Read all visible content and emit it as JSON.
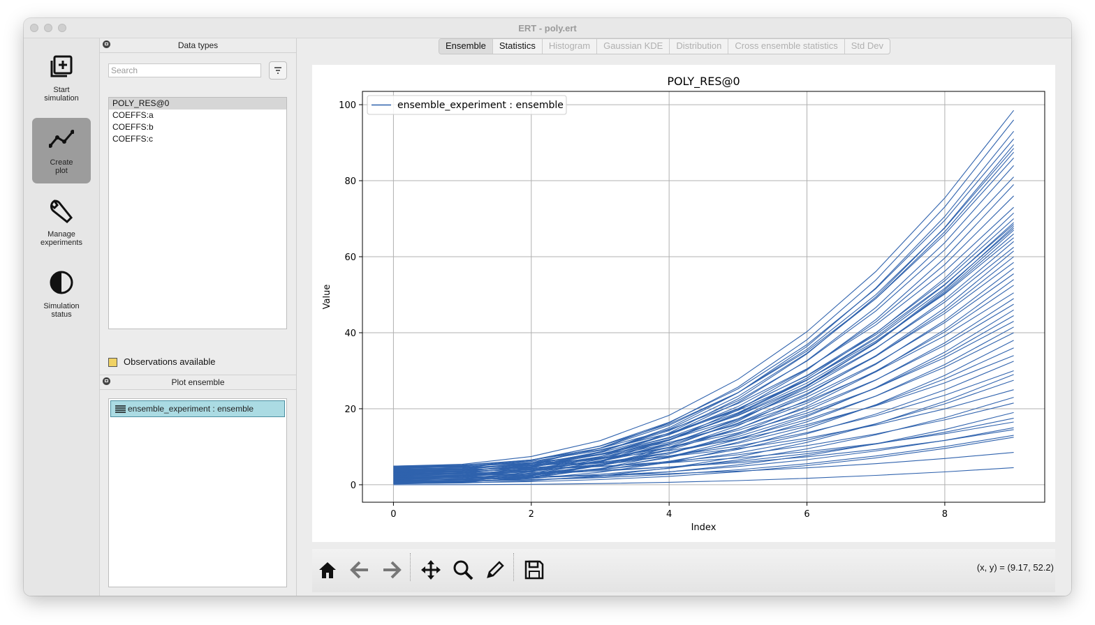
{
  "window": {
    "title": "ERT - poly.ert"
  },
  "sidebar": {
    "items": [
      {
        "label": "Start\nsimulation"
      },
      {
        "label": "Create\nplot"
      },
      {
        "label": "Manage\nexperiments"
      },
      {
        "label": "Simulation\nstatus"
      }
    ]
  },
  "data_types": {
    "title": "Data types",
    "search_placeholder": "Search",
    "items": [
      "POLY_RES@0",
      "COEFFS:a",
      "COEFFS:b",
      "COEFFS:c"
    ],
    "observations_label": "Observations available",
    "observations_color": "#f0d264"
  },
  "plot_ensemble": {
    "title": "Plot ensemble",
    "items": [
      "ensemble_experiment : ensemble"
    ]
  },
  "tabs": [
    "Ensemble",
    "Statistics",
    "Histogram",
    "Gaussian KDE",
    "Distribution",
    "Cross ensemble statistics",
    "Std Dev"
  ],
  "toolbar": {
    "coords": "(x, y) = (9.17, 52.2)"
  },
  "chart_data": {
    "type": "line",
    "title": "POLY_RES@0",
    "xlabel": "Index",
    "ylabel": "Value",
    "xlim": [
      -0.45,
      9.45
    ],
    "ylim": [
      -4.6,
      103.5
    ],
    "xticks": [
      0,
      2,
      4,
      6,
      8
    ],
    "yticks": [
      0,
      20,
      40,
      60,
      80,
      100
    ],
    "grid": true,
    "legend": "top-left",
    "legend_label": "ensemble_experiment : ensemble",
    "color": "#2f62ad",
    "x": [
      0,
      1,
      2,
      3,
      4,
      5,
      6,
      7,
      8,
      9
    ],
    "realization_endpoints": [
      {
        "y0": 0.0,
        "y9": 4.5
      },
      {
        "y0": 2.0,
        "y9": 8.5
      },
      {
        "y0": 0.5,
        "y9": 12.5
      },
      {
        "y0": 1.0,
        "y9": 13.0
      },
      {
        "y0": 3.0,
        "y9": 14.5
      },
      {
        "y0": 1.5,
        "y9": 15.0
      },
      {
        "y0": 4.0,
        "y9": 16.5
      },
      {
        "y0": 2.5,
        "y9": 17.5
      },
      {
        "y0": 0.8,
        "y9": 19.0
      },
      {
        "y0": 3.5,
        "y9": 21.5
      },
      {
        "y0": 1.2,
        "y9": 23.0
      },
      {
        "y0": 4.5,
        "y9": 25.0
      },
      {
        "y0": 2.2,
        "y9": 27.5
      },
      {
        "y0": 0.3,
        "y9": 29.0
      },
      {
        "y0": 3.8,
        "y9": 30.0
      },
      {
        "y0": 1.8,
        "y9": 32.5
      },
      {
        "y0": 4.8,
        "y9": 34.0
      },
      {
        "y0": 2.8,
        "y9": 36.0
      },
      {
        "y0": 0.6,
        "y9": 38.0
      },
      {
        "y0": 3.2,
        "y9": 40.0
      },
      {
        "y0": 1.4,
        "y9": 41.5
      },
      {
        "y0": 4.2,
        "y9": 43.0
      },
      {
        "y0": 2.4,
        "y9": 44.5
      },
      {
        "y0": 0.9,
        "y9": 46.0
      },
      {
        "y0": 3.6,
        "y9": 47.5
      },
      {
        "y0": 1.6,
        "y9": 49.0
      },
      {
        "y0": 4.6,
        "y9": 50.5
      },
      {
        "y0": 2.6,
        "y9": 52.5
      },
      {
        "y0": 0.4,
        "y9": 54.0
      },
      {
        "y0": 3.4,
        "y9": 55.5
      },
      {
        "y0": 1.1,
        "y9": 57.0
      },
      {
        "y0": 4.1,
        "y9": 58.5
      },
      {
        "y0": 2.1,
        "y9": 60.0
      },
      {
        "y0": 0.7,
        "y9": 61.5
      },
      {
        "y0": 3.9,
        "y9": 62.5
      },
      {
        "y0": 1.9,
        "y9": 64.0
      },
      {
        "y0": 4.9,
        "y9": 65.0
      },
      {
        "y0": 2.9,
        "y9": 66.0
      },
      {
        "y0": 1.3,
        "y9": 67.0
      },
      {
        "y0": 3.3,
        "y9": 67.5
      },
      {
        "y0": 0.2,
        "y9": 68.0
      },
      {
        "y0": 4.4,
        "y9": 68.5
      },
      {
        "y0": 2.3,
        "y9": 69.0
      },
      {
        "y0": 3.7,
        "y9": 70.0
      },
      {
        "y0": 1.7,
        "y9": 71.5
      },
      {
        "y0": 4.7,
        "y9": 73.0
      },
      {
        "y0": 2.7,
        "y9": 76.0
      },
      {
        "y0": 0.5,
        "y9": 79.0
      },
      {
        "y0": 3.1,
        "y9": 81.0
      },
      {
        "y0": 1.5,
        "y9": 84.0
      },
      {
        "y0": 4.3,
        "y9": 86.0
      },
      {
        "y0": 2.5,
        "y9": 87.5
      },
      {
        "y0": 3.5,
        "y9": 88.5
      },
      {
        "y0": 1.0,
        "y9": 89.5
      },
      {
        "y0": 4.0,
        "y9": 91.0
      },
      {
        "y0": 2.0,
        "y9": 93.0
      },
      {
        "y0": 3.0,
        "y9": 96.0
      },
      {
        "y0": 4.9,
        "y9": 98.5
      }
    ]
  }
}
